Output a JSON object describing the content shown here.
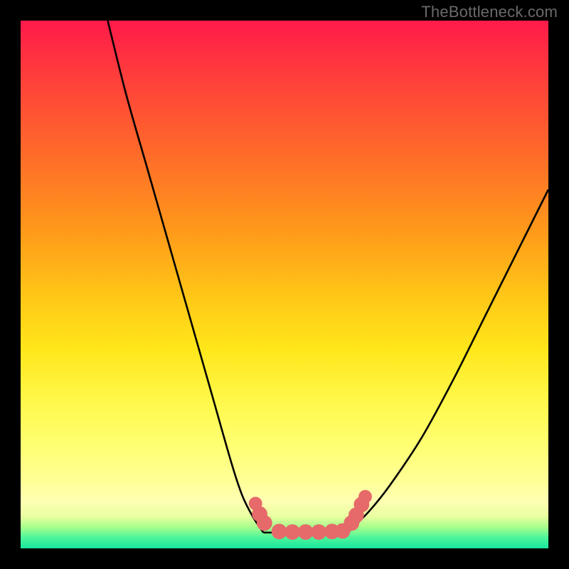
{
  "watermark": {
    "text": "TheBottleneck.com"
  },
  "colors": {
    "frame_bg": "#000000",
    "curve_stroke": "#000000",
    "marker_fill": "#e66a6a",
    "marker_stroke": "#e66a6a"
  },
  "chart_data": {
    "type": "line",
    "title": "",
    "xlabel": "",
    "ylabel": "",
    "xlim": [
      0,
      100
    ],
    "ylim": [
      0,
      100
    ],
    "grid": false,
    "series": [
      {
        "name": "left-curve",
        "x": [
          16.5,
          20,
          24,
          28,
          32,
          36,
          40,
          42,
          44,
          46
        ],
        "values": [
          100,
          86,
          72,
          58,
          44,
          30,
          16,
          10,
          6,
          3
        ]
      },
      {
        "name": "right-curve",
        "x": [
          62,
          66,
          70,
          76,
          82,
          88,
          94,
          100
        ],
        "values": [
          3,
          7,
          12,
          21,
          32,
          44,
          56,
          68
        ]
      },
      {
        "name": "flat-bottom",
        "x": [
          46,
          50,
          54,
          58,
          62
        ],
        "values": [
          3,
          3,
          3,
          3,
          3
        ]
      }
    ],
    "markers": [
      {
        "x": 44.5,
        "y": 8.5,
        "r": 1.2
      },
      {
        "x": 45.3,
        "y": 6.5,
        "r": 1.4
      },
      {
        "x": 46.2,
        "y": 4.8,
        "r": 1.4
      },
      {
        "x": 49.0,
        "y": 3.2,
        "r": 1.4
      },
      {
        "x": 51.5,
        "y": 3.1,
        "r": 1.4
      },
      {
        "x": 54.0,
        "y": 3.1,
        "r": 1.4
      },
      {
        "x": 56.5,
        "y": 3.1,
        "r": 1.4
      },
      {
        "x": 59.0,
        "y": 3.2,
        "r": 1.4
      },
      {
        "x": 61.0,
        "y": 3.3,
        "r": 1.4
      },
      {
        "x": 62.7,
        "y": 4.8,
        "r": 1.4
      },
      {
        "x": 63.6,
        "y": 6.3,
        "r": 1.4
      },
      {
        "x": 64.6,
        "y": 8.3,
        "r": 1.4
      },
      {
        "x": 65.3,
        "y": 9.8,
        "r": 1.2
      }
    ]
  }
}
